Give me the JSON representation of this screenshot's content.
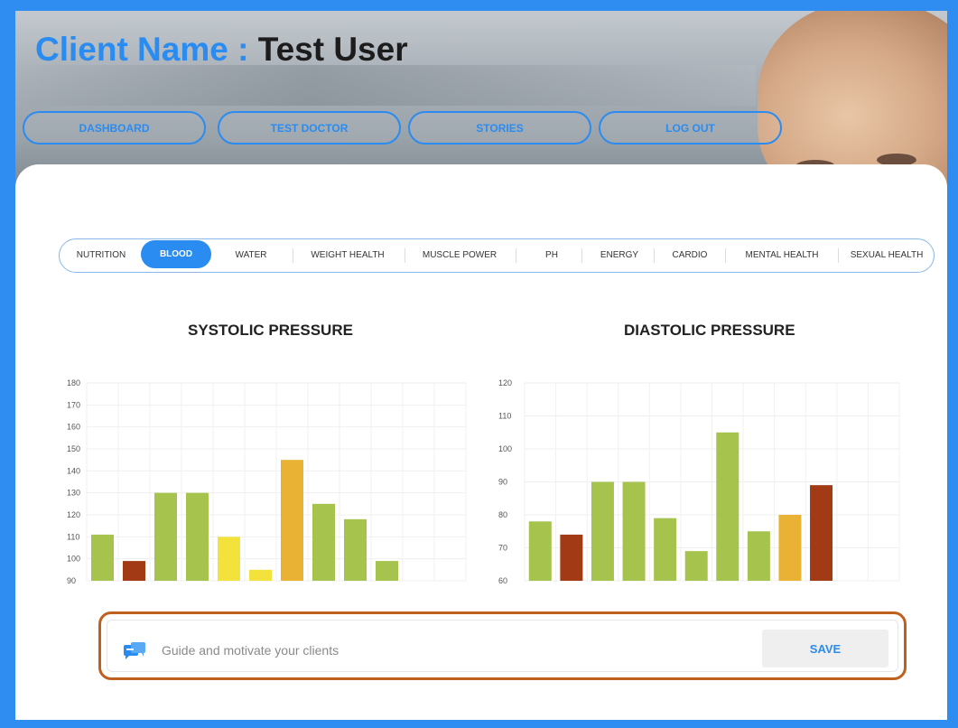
{
  "header": {
    "client_label": "Client Name :",
    "client_name": "Test User"
  },
  "nav": {
    "dashboard": "DASHBOARD",
    "test_doctor": "TEST DOCTOR",
    "stories": "STORIES",
    "log_out": "LOG OUT"
  },
  "tabs": [
    "NUTRITION",
    "BLOOD",
    "WATER",
    "WEIGHT HEALTH",
    "MUSCLE POWER",
    "PH",
    "ENERGY",
    "CARDIO",
    "MENTAL HEALTH",
    "SEXUAL HEALTH"
  ],
  "active_tab": "BLOOD",
  "colors": {
    "accent": "#2a8cf0",
    "green": "#a6c34e",
    "dark_red": "#a23b15",
    "yellow": "#f3e13c",
    "amber": "#e9b234",
    "guide_border": "#c0601f"
  },
  "chart_data": [
    {
      "type": "bar",
      "title": "SYSTOLIC PRESSURE",
      "values": [
        111,
        99,
        130,
        130,
        110,
        95,
        145,
        125,
        118,
        99
      ],
      "colors": [
        "#a6c34e",
        "#a23b15",
        "#a6c34e",
        "#a6c34e",
        "#f3e13c",
        "#f3e13c",
        "#e9b234",
        "#a6c34e",
        "#a6c34e",
        "#a6c34e"
      ],
      "ylim": [
        90,
        180
      ],
      "ticks": [
        180,
        170,
        160,
        150,
        140,
        130,
        120,
        110,
        100,
        90
      ],
      "slots": 12,
      "grid": true
    },
    {
      "type": "bar",
      "title": "DIASTOLIC PRESSURE",
      "values": [
        78,
        74,
        90,
        90,
        79,
        69,
        105,
        75,
        80,
        89
      ],
      "colors": [
        "#a6c34e",
        "#a23b15",
        "#a6c34e",
        "#a6c34e",
        "#a6c34e",
        "#a6c34e",
        "#a6c34e",
        "#a6c34e",
        "#e9b234",
        "#a23b15"
      ],
      "ylim": [
        60,
        120
      ],
      "ticks": [
        120,
        110,
        100,
        90,
        80,
        70,
        60
      ],
      "slots": 12,
      "grid": true
    }
  ],
  "guide": {
    "placeholder": "Guide and motivate your clients",
    "save_label": "SAVE",
    "icon": "chat-bubbles-icon"
  }
}
